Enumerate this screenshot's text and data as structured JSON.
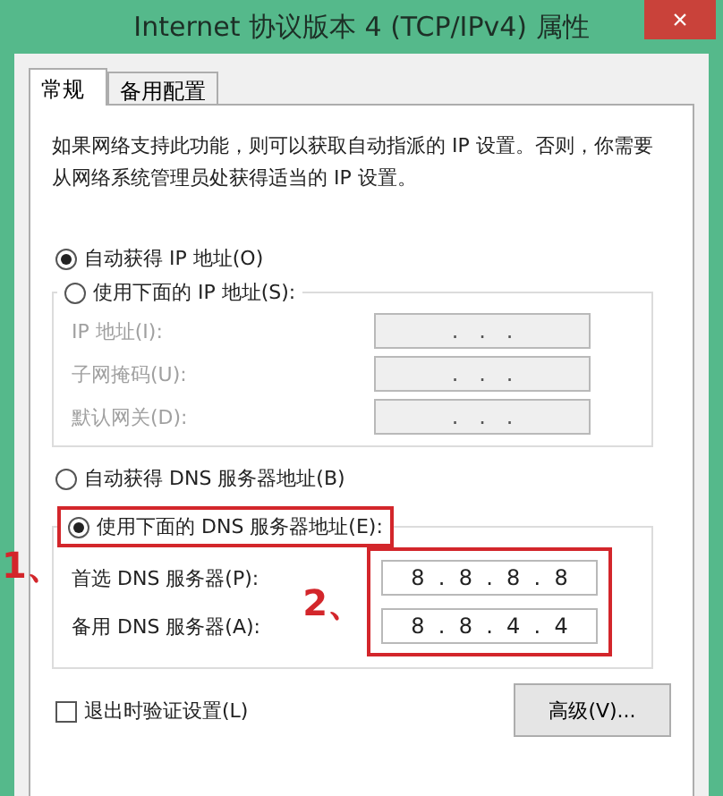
{
  "window": {
    "title": "Internet 协议版本 4 (TCP/IPv4) 属性",
    "close": "×"
  },
  "tabs": [
    {
      "label": "常规",
      "selected": true
    },
    {
      "label": "备用配置",
      "selected": false
    }
  ],
  "description": "如果网络支持此功能，则可以获取自动指派的 IP 设置。否则，你需要从网络系统管理员处获得适当的 IP 设置。",
  "ip_mode": [
    {
      "label": "自动获得 IP 地址(O)",
      "selected": true
    },
    {
      "label": "使用下面的 IP 地址(S):",
      "selected": false
    }
  ],
  "ip_fields": [
    {
      "label": "IP 地址(I):",
      "value": ".   .   .",
      "disabled": true
    },
    {
      "label": "子网掩码(U):",
      "value": ".   .   .",
      "disabled": true
    },
    {
      "label": "默认网关(D):",
      "value": ".   .   .",
      "disabled": true
    }
  ],
  "dns_mode": [
    {
      "label": "自动获得 DNS 服务器地址(B)",
      "selected": false
    },
    {
      "label": "使用下面的 DNS 服务器地址(E):",
      "selected": true
    }
  ],
  "dns_fields": [
    {
      "label": "首选 DNS 服务器(P):",
      "value": "8  .  8  .  8  .  8",
      "disabled": false
    },
    {
      "label": "备用 DNS 服务器(A):",
      "value": "8  .  8  .  4  .  4",
      "disabled": false
    }
  ],
  "validate_on_exit": {
    "label": "退出时验证设置(L)",
    "checked": false
  },
  "advanced_button": "高级(V)...",
  "annotations": [
    {
      "label": "1、"
    },
    {
      "label": "2、"
    }
  ]
}
